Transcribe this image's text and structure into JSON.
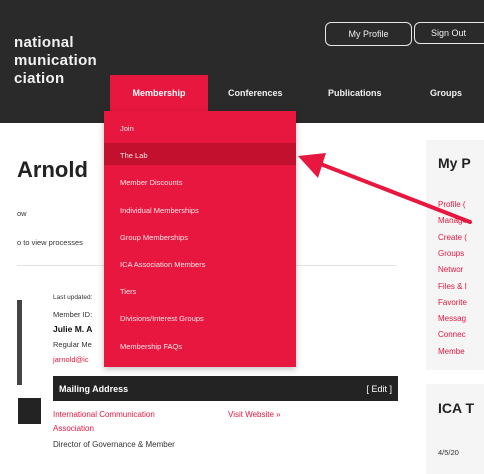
{
  "header": {
    "org_name": "national\nmunication\nciation",
    "my_profile": "My Profile",
    "sign_out": "Sign Out",
    "nav": [
      "Membership",
      "Conferences",
      "Publications",
      "Groups"
    ]
  },
  "dropdown": {
    "items": [
      "Join",
      "The Lab",
      "Member Discounts",
      "Individual Memberships",
      "Group Memberships",
      "ICA Association Members",
      "Tiers",
      "Divisions/Interest Groups",
      "Membership FAQs"
    ],
    "highlighted_index": 1
  },
  "main": {
    "name": "Arnold",
    "text1": "ow",
    "text2": "o to view processes",
    "last_updated": "Last updated:",
    "member_id": "Member ID:",
    "person_name": "Julie M. A",
    "person_type": "Regular Me",
    "email": "jarnold@ic",
    "mailing_bar": "Mailing Address",
    "edit": "[ Edit ]",
    "org_line1": "International Communication",
    "org_line2": "Association",
    "visit": "Visit Website »",
    "role": "Director of Governance & Member"
  },
  "sidebar": {
    "title": "My P",
    "links": [
      "Profile (",
      "Manage",
      "Create (",
      "Groups",
      "Networ",
      "Files & I",
      "Favorite",
      "Messag",
      "Connec",
      "Membe"
    ],
    "title2": "ICA T",
    "date": "4/5/20"
  },
  "colors": {
    "accent": "#e8173f",
    "header": "#2a2a2a",
    "arrow": "#e8173f"
  }
}
